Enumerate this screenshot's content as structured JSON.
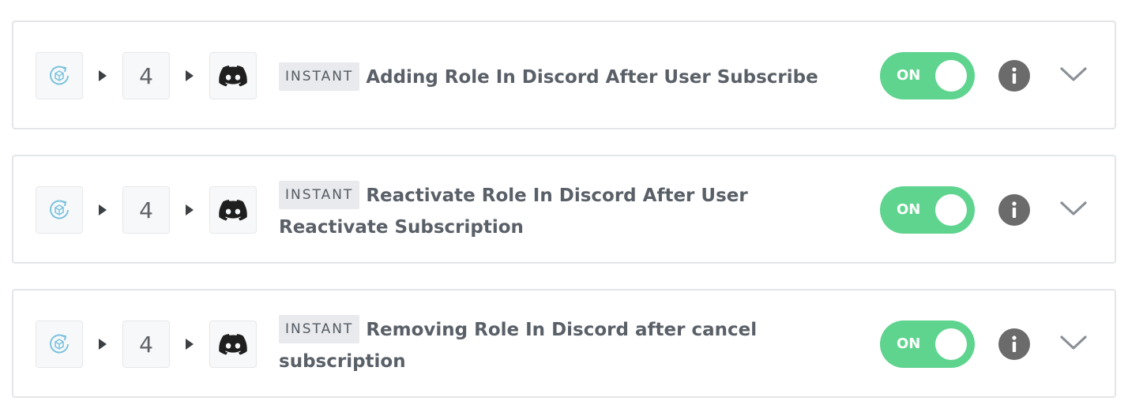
{
  "zaps": [
    {
      "trigger_app_icon": "app-cycle-icon",
      "step_count": "4",
      "action_app_icon": "discord-icon",
      "badge": "INSTANT",
      "title": "Adding Role In Discord After User Subscribe",
      "toggle_label": "ON",
      "info_icon": "info-icon",
      "expand_icon": "chevron-down-icon"
    },
    {
      "trigger_app_icon": "app-cycle-icon",
      "step_count": "4",
      "action_app_icon": "discord-icon",
      "badge": "INSTANT",
      "title": "Reactivate Role In Discord After User Reactivate Subscription",
      "toggle_label": "ON",
      "info_icon": "info-icon",
      "expand_icon": "chevron-down-icon"
    },
    {
      "trigger_app_icon": "app-cycle-icon",
      "step_count": "4",
      "action_app_icon": "discord-icon",
      "badge": "INSTANT",
      "title": "Removing Role In Discord after cancel subscription",
      "toggle_label": "ON",
      "info_icon": "info-icon",
      "expand_icon": "chevron-down-icon"
    }
  ],
  "colors": {
    "toggle_on": "#5ed48e",
    "info_bg": "#6b6b6b",
    "title_text": "#5a6068",
    "badge_bg": "#e8eaed",
    "app_icon": "#7cc3de"
  }
}
